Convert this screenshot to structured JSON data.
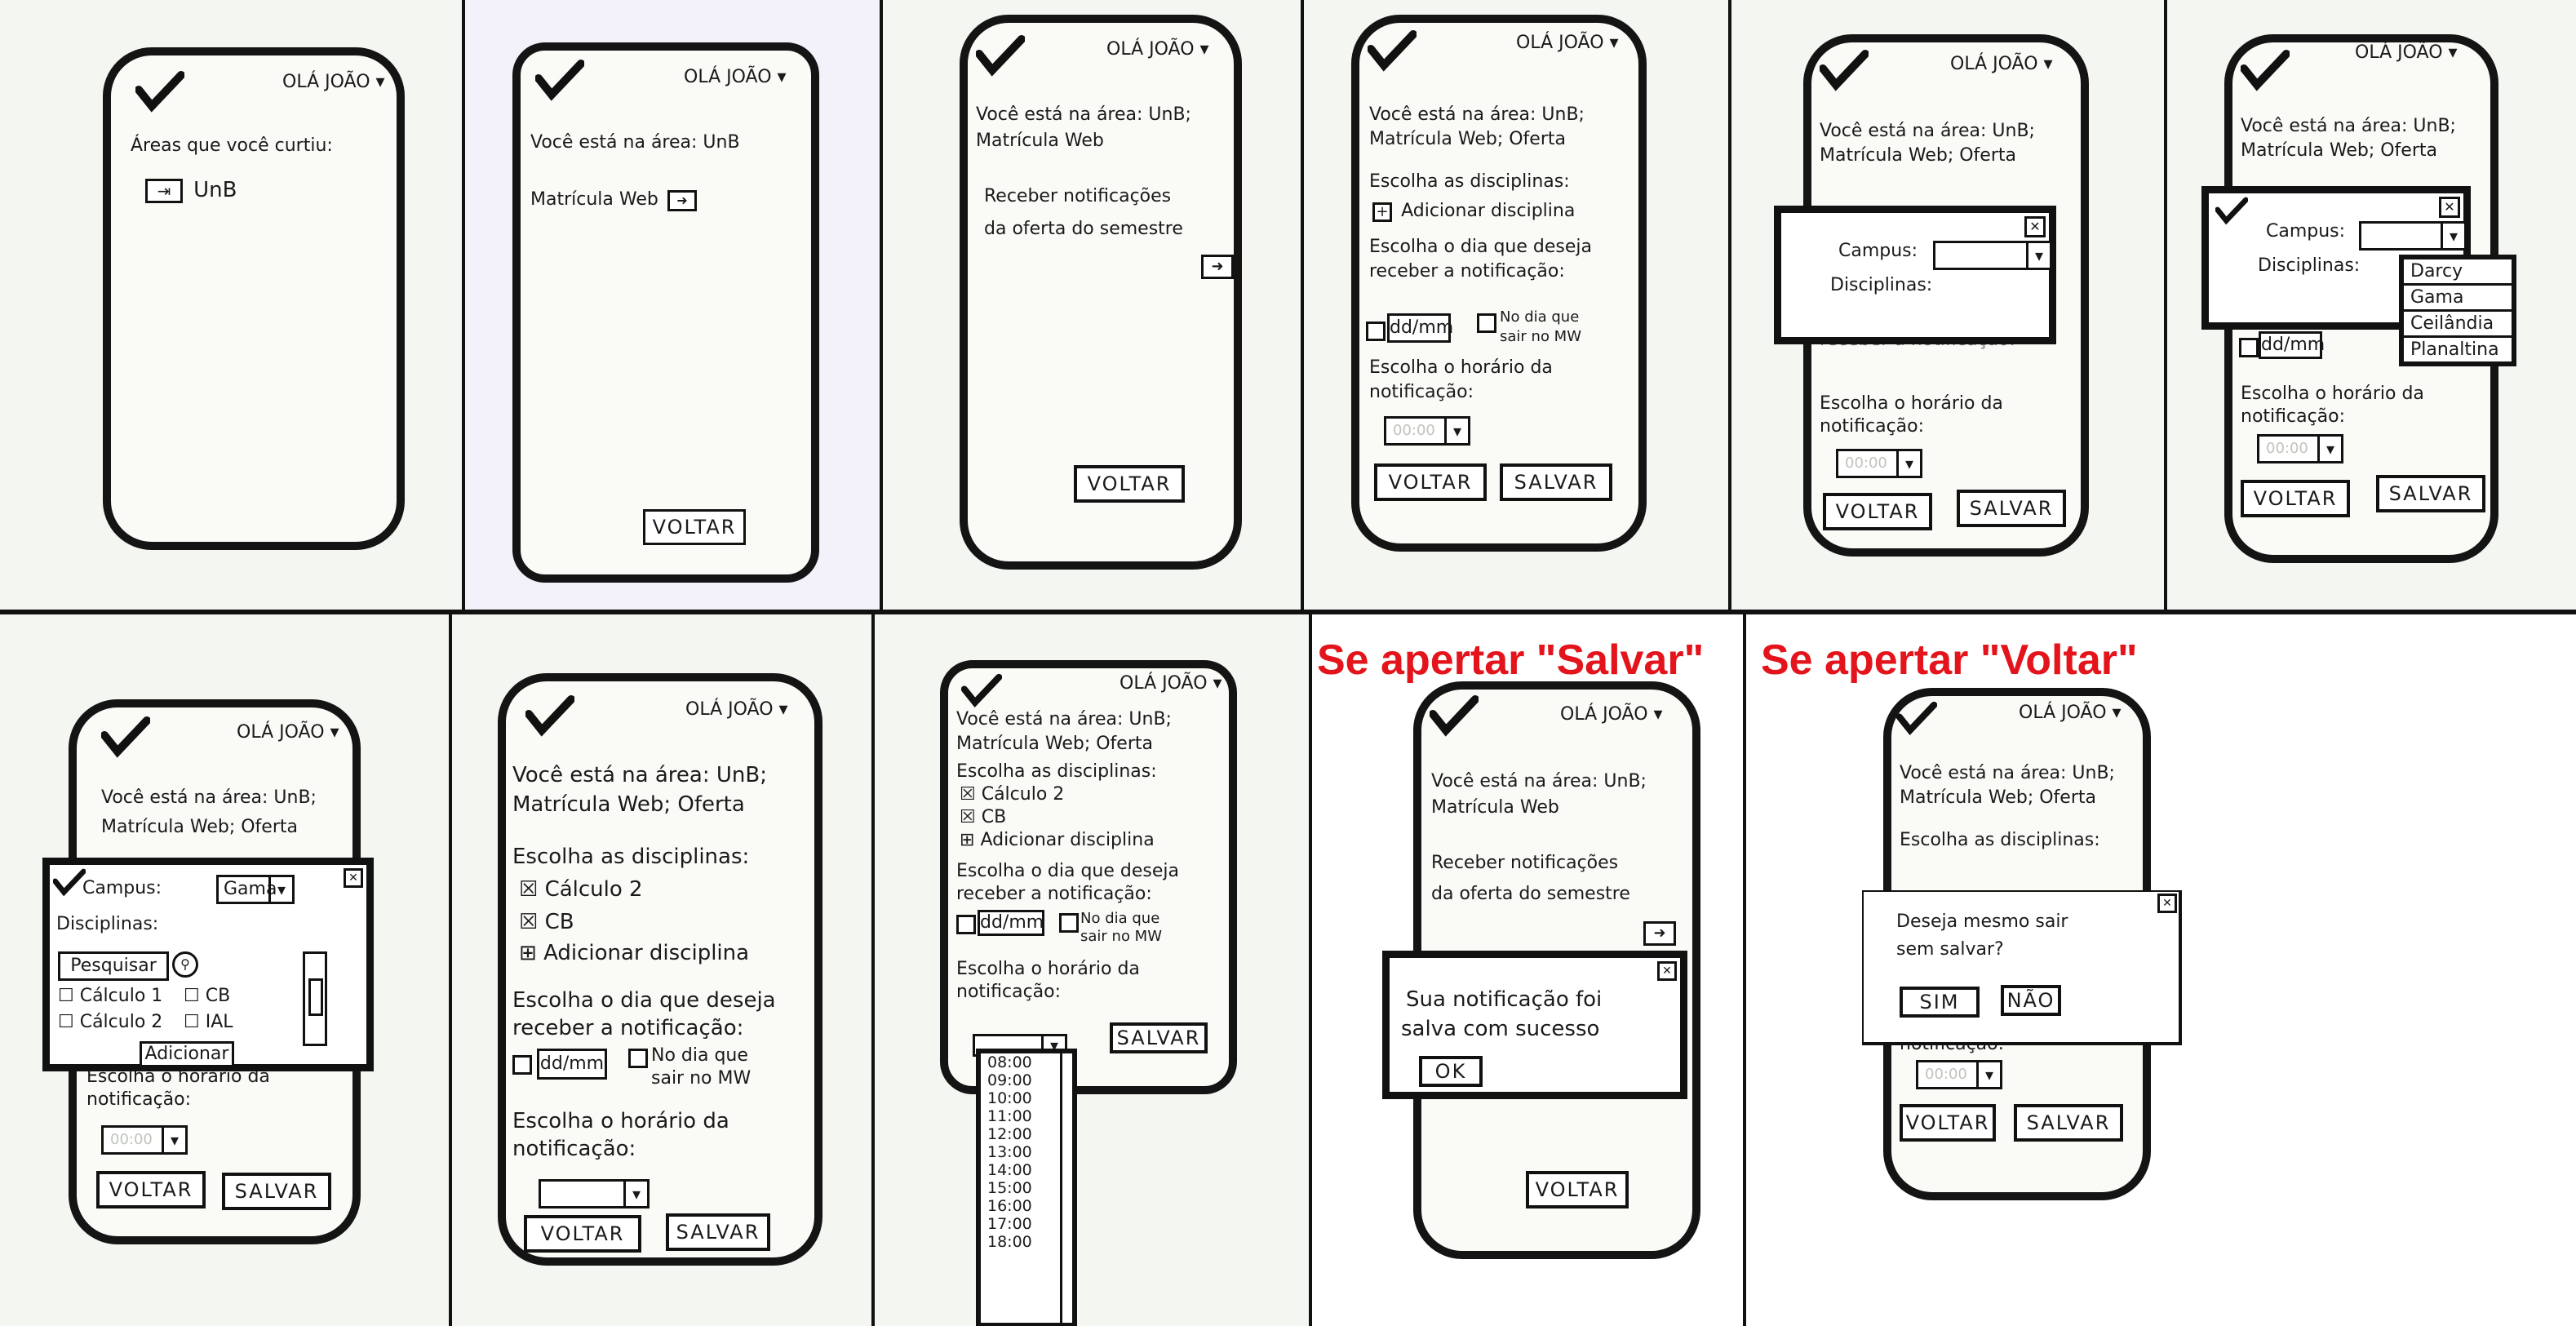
{
  "header": {
    "greeting": "OLÁ JOÃO"
  },
  "labels": {
    "areas_curtiu": "Áreas que você curtiu:",
    "unb": "UnB",
    "voce_area_unb": "Você está na área: UnB",
    "voce_area_unb_sc": "Você está na área: UnB;",
    "matricula_web": "Matrícula Web",
    "matricula_oferta": "Matrícula Web; Oferta",
    "receber_notif_1": "Receber notificações",
    "receber_notif_2": "da oferta do semestre",
    "escolha_disc": "Escolha as disciplinas:",
    "adicionar_disc": "Adicionar disciplina",
    "escolha_dia_1": "Escolha o dia que deseja",
    "escolha_dia_2": "receber a notificação:",
    "ddmm": "dd/mm",
    "no_dia_1": "No dia que",
    "no_dia_2": "sair no MW",
    "escolha_hora_1": "Escolha o horário da",
    "escolha_hora_2": "notificação:",
    "hora_val": "00:00",
    "campus": "Campus:",
    "disciplinas": "Disciplinas:",
    "gama": "Gama",
    "pesquisar": "Pesquisar",
    "calculo1": "Cálculo 1",
    "calculo2": "Cálculo 2",
    "cb": "CB",
    "ial": "IAL",
    "adicionar": "Adicionar",
    "sucesso_1": "Sua notificação foi",
    "sucesso_2": "salva com sucesso",
    "ok": "OK",
    "deseja_1": "Deseja mesmo sair",
    "deseja_2": "sem salvar?",
    "sim": "SIM",
    "nao": "NÃO"
  },
  "buttons": {
    "voltar": "VOLTAR",
    "salvar": "SALVAR"
  },
  "campus_options": [
    "Darcy",
    "Gama",
    "Ceilândia",
    "Planaltina"
  ],
  "hours": [
    "08:00",
    "09:00",
    "10:00",
    "11:00",
    "12:00",
    "13:00",
    "14:00",
    "15:00",
    "16:00",
    "17:00",
    "18:00"
  ],
  "captions": {
    "salvar": "Se apertar \"Salvar\"",
    "voltar": "Se apertar \"Voltar\""
  }
}
